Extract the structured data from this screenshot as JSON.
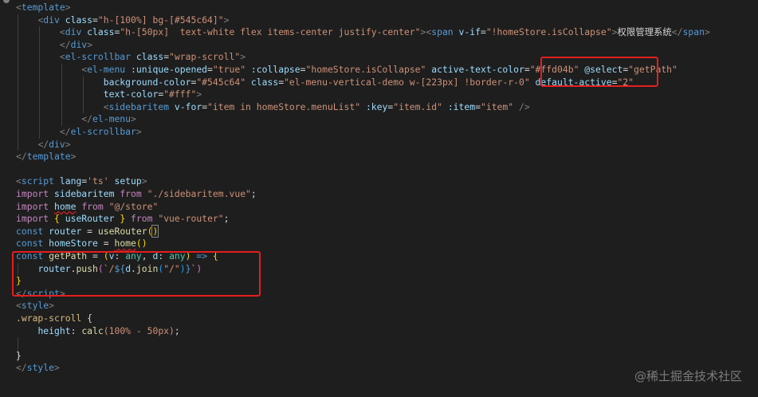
{
  "editor": {
    "lines": [
      [
        {
          "t": "<",
          "c": "tok-punct"
        },
        {
          "t": "template",
          "c": "tok-tag"
        },
        {
          "t": ">",
          "c": "tok-punct"
        }
      ],
      [
        {
          "t": "    ",
          "c": "tok-plain"
        },
        {
          "t": "<",
          "c": "tok-punct"
        },
        {
          "t": "div",
          "c": "tok-tag"
        },
        {
          "t": " ",
          "c": "tok-plain"
        },
        {
          "t": "class",
          "c": "tok-attr"
        },
        {
          "t": "=",
          "c": "tok-plain"
        },
        {
          "t": "\"h-[100%] bg-[#545c64]\"",
          "c": "tok-str"
        },
        {
          "t": ">",
          "c": "tok-punct"
        }
      ],
      [
        {
          "t": "        ",
          "c": "tok-plain"
        },
        {
          "t": "<",
          "c": "tok-punct"
        },
        {
          "t": "div",
          "c": "tok-tag"
        },
        {
          "t": " ",
          "c": "tok-plain"
        },
        {
          "t": "class",
          "c": "tok-attr"
        },
        {
          "t": "=",
          "c": "tok-plain"
        },
        {
          "t": "\"h-[50px]  text-white flex items-center justify-center\"",
          "c": "tok-str"
        },
        {
          "t": ">",
          "c": "tok-punct"
        },
        {
          "t": "<",
          "c": "tok-punct"
        },
        {
          "t": "span",
          "c": "tok-tag"
        },
        {
          "t": " ",
          "c": "tok-plain"
        },
        {
          "t": "v-if",
          "c": "tok-attr"
        },
        {
          "t": "=",
          "c": "tok-plain"
        },
        {
          "t": "\"!homeStore.isCollapse\"",
          "c": "tok-str"
        },
        {
          "t": ">",
          "c": "tok-punct"
        },
        {
          "t": "权限管理系统",
          "c": "tok-text"
        },
        {
          "t": "</",
          "c": "tok-punct"
        },
        {
          "t": "span",
          "c": "tok-tag"
        },
        {
          "t": ">",
          "c": "tok-punct"
        }
      ],
      [
        {
          "t": "        ",
          "c": "tok-plain"
        },
        {
          "t": "</",
          "c": "tok-punct"
        },
        {
          "t": "div",
          "c": "tok-tag"
        },
        {
          "t": ">",
          "c": "tok-punct"
        }
      ],
      [
        {
          "t": "        ",
          "c": "tok-plain"
        },
        {
          "t": "<",
          "c": "tok-punct"
        },
        {
          "t": "el-scrollbar",
          "c": "tok-tag"
        },
        {
          "t": " ",
          "c": "tok-plain"
        },
        {
          "t": "class",
          "c": "tok-attr"
        },
        {
          "t": "=",
          "c": "tok-plain"
        },
        {
          "t": "\"wrap-scroll\"",
          "c": "tok-str"
        },
        {
          "t": ">",
          "c": "tok-punct"
        }
      ],
      [
        {
          "t": "            ",
          "c": "tok-plain"
        },
        {
          "t": "<",
          "c": "tok-punct"
        },
        {
          "t": "el-menu",
          "c": "tok-tag"
        },
        {
          "t": " ",
          "c": "tok-plain"
        },
        {
          "t": ":unique-opened",
          "c": "tok-attr"
        },
        {
          "t": "=",
          "c": "tok-plain"
        },
        {
          "t": "\"true\"",
          "c": "tok-str"
        },
        {
          "t": " ",
          "c": "tok-plain"
        },
        {
          "t": ":collapse",
          "c": "tok-attr"
        },
        {
          "t": "=",
          "c": "tok-plain"
        },
        {
          "t": "\"homeStore.isCollapse\"",
          "c": "tok-str"
        },
        {
          "t": " ",
          "c": "tok-plain"
        },
        {
          "t": "active-text-color",
          "c": "tok-attr"
        },
        {
          "t": "=",
          "c": "tok-plain"
        },
        {
          "t": "\"#ffd04b\"",
          "c": "tok-str"
        },
        {
          "t": " ",
          "c": "tok-plain"
        },
        {
          "t": "@select",
          "c": "tok-attr"
        },
        {
          "t": "=",
          "c": "tok-plain"
        },
        {
          "t": "\"getPath\"",
          "c": "tok-str"
        }
      ],
      [
        {
          "t": "                ",
          "c": "tok-plain"
        },
        {
          "t": "background-color",
          "c": "tok-attr"
        },
        {
          "t": "=",
          "c": "tok-plain"
        },
        {
          "t": "\"#545c64\"",
          "c": "tok-str"
        },
        {
          "t": " ",
          "c": "tok-plain"
        },
        {
          "t": "class",
          "c": "tok-attr"
        },
        {
          "t": "=",
          "c": "tok-plain"
        },
        {
          "t": "\"el-menu-vertical-demo w-[223px] !border-r-0\"",
          "c": "tok-str"
        },
        {
          "t": " ",
          "c": "tok-plain"
        },
        {
          "t": "default-active",
          "c": "tok-attr"
        },
        {
          "t": "=",
          "c": "tok-plain"
        },
        {
          "t": "\"2\"",
          "c": "tok-str"
        }
      ],
      [
        {
          "t": "                ",
          "c": "tok-plain"
        },
        {
          "t": "text-color",
          "c": "tok-attr"
        },
        {
          "t": "=",
          "c": "tok-plain"
        },
        {
          "t": "\"#fff\"",
          "c": "tok-str"
        },
        {
          "t": ">",
          "c": "tok-punct"
        }
      ],
      [
        {
          "t": "                ",
          "c": "tok-plain"
        },
        {
          "t": "<",
          "c": "tok-punct"
        },
        {
          "t": "sidebaritem",
          "c": "tok-tag"
        },
        {
          "t": " ",
          "c": "tok-plain"
        },
        {
          "t": "v-for",
          "c": "tok-attr"
        },
        {
          "t": "=",
          "c": "tok-plain"
        },
        {
          "t": "\"item in homeStore.menuList\"",
          "c": "tok-str"
        },
        {
          "t": " ",
          "c": "tok-plain"
        },
        {
          "t": ":key",
          "c": "tok-attr"
        },
        {
          "t": "=",
          "c": "tok-plain"
        },
        {
          "t": "\"item.id\"",
          "c": "tok-str"
        },
        {
          "t": " ",
          "c": "tok-plain"
        },
        {
          "t": ":item",
          "c": "tok-attr"
        },
        {
          "t": "=",
          "c": "tok-plain"
        },
        {
          "t": "\"item\"",
          "c": "tok-str"
        },
        {
          "t": " />",
          "c": "tok-punct"
        }
      ],
      [
        {
          "t": "            ",
          "c": "tok-plain"
        },
        {
          "t": "</",
          "c": "tok-punct"
        },
        {
          "t": "el-menu",
          "c": "tok-tag"
        },
        {
          "t": ">",
          "c": "tok-punct"
        }
      ],
      [
        {
          "t": "        ",
          "c": "tok-plain"
        },
        {
          "t": "</",
          "c": "tok-punct"
        },
        {
          "t": "el-scrollbar",
          "c": "tok-tag"
        },
        {
          "t": ">",
          "c": "tok-punct"
        }
      ],
      [
        {
          "t": "    ",
          "c": "tok-plain"
        },
        {
          "t": "</",
          "c": "tok-punct"
        },
        {
          "t": "div",
          "c": "tok-tag"
        },
        {
          "t": ">",
          "c": "tok-punct"
        }
      ],
      [
        {
          "t": "</",
          "c": "tok-punct"
        },
        {
          "t": "template",
          "c": "tok-tag"
        },
        {
          "t": ">",
          "c": "tok-punct"
        }
      ],
      [],
      [
        {
          "t": "<",
          "c": "tok-punct"
        },
        {
          "t": "script",
          "c": "tok-tag"
        },
        {
          "t": " ",
          "c": "tok-plain"
        },
        {
          "t": "lang",
          "c": "tok-attr"
        },
        {
          "t": "=",
          "c": "tok-plain"
        },
        {
          "t": "'ts'",
          "c": "tok-str"
        },
        {
          "t": " ",
          "c": "tok-plain"
        },
        {
          "t": "setup",
          "c": "tok-attr"
        },
        {
          "t": ">",
          "c": "tok-punct"
        }
      ],
      [
        {
          "t": "import",
          "c": "tok-kw"
        },
        {
          "t": " ",
          "c": "tok-plain"
        },
        {
          "t": "sidebaritem",
          "c": "tok-var"
        },
        {
          "t": " ",
          "c": "tok-plain"
        },
        {
          "t": "from",
          "c": "tok-kw"
        },
        {
          "t": " ",
          "c": "tok-plain"
        },
        {
          "t": "\"./sidebaritem.vue\"",
          "c": "tok-str"
        },
        {
          "t": ";",
          "c": "tok-plain"
        }
      ],
      [
        {
          "t": "import",
          "c": "tok-kw"
        },
        {
          "t": " ",
          "c": "tok-plain"
        },
        {
          "t": "home",
          "c": "tok-var home-ul"
        },
        {
          "t": " ",
          "c": "tok-plain"
        },
        {
          "t": "from",
          "c": "tok-kw"
        },
        {
          "t": " ",
          "c": "tok-plain"
        },
        {
          "t": "\"@/store\"",
          "c": "tok-str"
        }
      ],
      [
        {
          "t": "import",
          "c": "tok-kw"
        },
        {
          "t": " ",
          "c": "tok-plain"
        },
        {
          "t": "{",
          "c": "tok-brace2"
        },
        {
          "t": " ",
          "c": "tok-plain"
        },
        {
          "t": "useRouter",
          "c": "tok-var"
        },
        {
          "t": " ",
          "c": "tok-plain"
        },
        {
          "t": "}",
          "c": "tok-brace2"
        },
        {
          "t": " ",
          "c": "tok-plain"
        },
        {
          "t": "from",
          "c": "tok-kw"
        },
        {
          "t": " ",
          "c": "tok-plain"
        },
        {
          "t": "\"vue-router\"",
          "c": "tok-str"
        },
        {
          "t": ";",
          "c": "tok-plain"
        }
      ],
      [
        {
          "t": "const",
          "c": "tok-decl"
        },
        {
          "t": " ",
          "c": "tok-plain"
        },
        {
          "t": "router",
          "c": "tok-var"
        },
        {
          "t": " = ",
          "c": "tok-plain"
        },
        {
          "t": "useRouter",
          "c": "tok-fn"
        },
        {
          "t": "(",
          "c": "tok-brace2"
        },
        {
          "t": ")",
          "c": "tok-brace2 bracket-match"
        }
      ],
      [
        {
          "t": "const",
          "c": "tok-decl"
        },
        {
          "t": " ",
          "c": "tok-plain"
        },
        {
          "t": "homeStore",
          "c": "tok-var"
        },
        {
          "t": " = ",
          "c": "tok-plain"
        },
        {
          "t": "home",
          "c": "tok-fn home-ul"
        },
        {
          "t": "()",
          "c": "tok-brace2"
        }
      ],
      [
        {
          "t": "const",
          "c": "tok-decl"
        },
        {
          "t": " ",
          "c": "tok-plain"
        },
        {
          "t": "getPath",
          "c": "tok-fn"
        },
        {
          "t": " = ",
          "c": "tok-plain"
        },
        {
          "t": "(",
          "c": "tok-brace2"
        },
        {
          "t": "v",
          "c": "tok-var"
        },
        {
          "t": ": ",
          "c": "tok-plain"
        },
        {
          "t": "any",
          "c": "tok-type"
        },
        {
          "t": ", ",
          "c": "tok-plain"
        },
        {
          "t": "d",
          "c": "tok-var"
        },
        {
          "t": ": ",
          "c": "tok-plain"
        },
        {
          "t": "any",
          "c": "tok-type"
        },
        {
          "t": ")",
          "c": "tok-brace2"
        },
        {
          "t": " ",
          "c": "tok-plain"
        },
        {
          "t": "=>",
          "c": "tok-decl"
        },
        {
          "t": " ",
          "c": "tok-plain"
        },
        {
          "t": "{",
          "c": "tok-brace2"
        }
      ],
      [
        {
          "t": "    ",
          "c": "tok-plain"
        },
        {
          "t": "router",
          "c": "tok-var"
        },
        {
          "t": ".",
          "c": "tok-plain"
        },
        {
          "t": "push",
          "c": "tok-fn"
        },
        {
          "t": "(",
          "c": "tok-brace"
        },
        {
          "t": "`/",
          "c": "tok-str"
        },
        {
          "t": "${",
          "c": "tok-tplpunct"
        },
        {
          "t": "d",
          "c": "tok-var"
        },
        {
          "t": ".",
          "c": "tok-plain"
        },
        {
          "t": "join",
          "c": "tok-fn"
        },
        {
          "t": "(",
          "c": "tok-brace3"
        },
        {
          "t": "\"/\"",
          "c": "tok-str"
        },
        {
          "t": ")",
          "c": "tok-brace3"
        },
        {
          "t": "}",
          "c": "tok-tplpunct"
        },
        {
          "t": "`",
          "c": "tok-str"
        },
        {
          "t": ")",
          "c": "tok-brace"
        }
      ],
      [
        {
          "t": "}",
          "c": "tok-brace2"
        }
      ],
      [
        {
          "t": "</",
          "c": "tok-punct"
        },
        {
          "t": "script",
          "c": "tok-tag"
        },
        {
          "t": ">",
          "c": "tok-punct"
        }
      ],
      [
        {
          "t": "<",
          "c": "tok-punct"
        },
        {
          "t": "style",
          "c": "tok-tag"
        },
        {
          "t": ">",
          "c": "tok-punct"
        }
      ],
      [
        {
          "t": ".wrap-scroll",
          "c": "tok-sel"
        },
        {
          "t": " ",
          "c": "tok-plain"
        },
        {
          "t": "{",
          "c": "tok-plain"
        }
      ],
      [
        {
          "t": "    ",
          "c": "tok-plain"
        },
        {
          "t": "height",
          "c": "tok-prop"
        },
        {
          "t": ": ",
          "c": "tok-plain"
        },
        {
          "t": "calc",
          "c": "tok-fn"
        },
        {
          "t": "(100% - 50px)",
          "c": "tok-str"
        },
        {
          "t": ";",
          "c": "tok-plain"
        }
      ],
      [],
      [
        {
          "t": "}",
          "c": "tok-plain"
        }
      ],
      [
        {
          "t": "</",
          "c": "tok-punct"
        },
        {
          "t": "style",
          "c": "tok-tag"
        },
        {
          "t": ">",
          "c": "tok-punct"
        }
      ]
    ]
  },
  "watermark": "@稀土掘金技术社区",
  "colors": {
    "background": "#1e1e1e",
    "highlight_box": "#e51e1e"
  }
}
